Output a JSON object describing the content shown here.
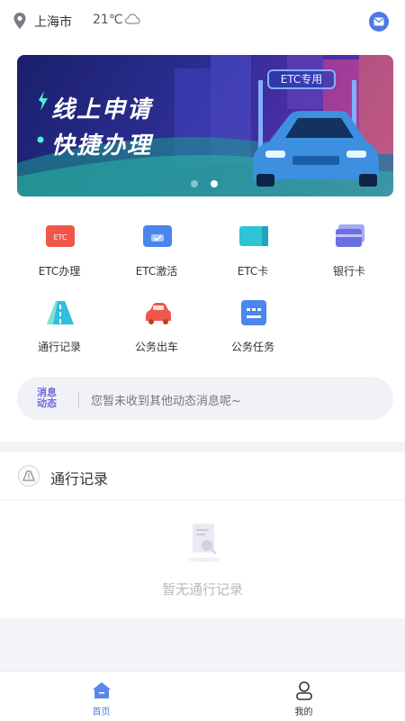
{
  "header": {
    "location_icon": "map-pin-icon",
    "city": "上海市",
    "temperature": "21℃",
    "weather_icon": "cloud-icon",
    "mail_icon": "mail-icon"
  },
  "banner": {
    "line1": "线上申请",
    "line2": "快捷办理",
    "tag": "ETC专用",
    "carousel": {
      "count": 2,
      "active": 2
    }
  },
  "menu": [
    {
      "label": "ETC办理",
      "icon": "etc-apply-icon",
      "color": "#f0564a"
    },
    {
      "label": "ETC激活",
      "icon": "etc-activate-icon",
      "color": "#4b86ee"
    },
    {
      "label": "ETC卡",
      "icon": "etc-card-icon",
      "color": "#2fc3d6"
    },
    {
      "label": "银行卡",
      "icon": "bank-card-icon",
      "color": "#6a70e2"
    },
    {
      "label": "通行记录",
      "icon": "road-icon",
      "color": "#2fbde0"
    },
    {
      "label": "公务出车",
      "icon": "car-icon",
      "color": "#f0564a"
    },
    {
      "label": "公务任务",
      "icon": "task-icon",
      "color": "#4b86ee"
    }
  ],
  "notice": {
    "tag_line1": "消息",
    "tag_line2": "动态",
    "text": "您暂未收到其他动态消息呢~"
  },
  "records": {
    "title": "通行记录",
    "icon": "road-icon",
    "empty_text": "暂无通行记录",
    "empty_icon": "empty-document-icon"
  },
  "bottom_nav": [
    {
      "label": "首页",
      "icon": "home-icon",
      "active": true
    },
    {
      "label": "我的",
      "icon": "user-icon",
      "active": false
    }
  ],
  "colors": {
    "accent": "#4f79e6",
    "background": "#f3f4f9"
  }
}
